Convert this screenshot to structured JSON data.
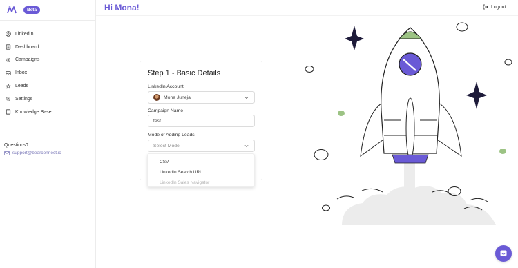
{
  "brand": {
    "badge": "Beta"
  },
  "header": {
    "greeting": "Hi Mona!",
    "logout_label": "Logout"
  },
  "sidebar": {
    "items": [
      {
        "label": "LinkedIn",
        "icon": "user-circle-icon"
      },
      {
        "label": "Dashboard",
        "icon": "document-icon"
      },
      {
        "label": "Campaigns",
        "icon": "gear-icon"
      },
      {
        "label": "Inbox",
        "icon": "inbox-icon"
      },
      {
        "label": "Leads",
        "icon": "star-icon"
      },
      {
        "label": "Settings",
        "icon": "gear-icon"
      },
      {
        "label": "Knowledge Base",
        "icon": "book-icon"
      }
    ],
    "questions_label": "Questions?",
    "support_email": "support@bearconnect.io"
  },
  "form": {
    "title": "Step 1 - Basic Details",
    "linkedin_account_label": "LinkedIn Account",
    "linkedin_account_value": "Mona Juneja",
    "campaign_name_label": "Campaign Name",
    "campaign_name_value": "test",
    "mode_label": "Mode of Adding Leads",
    "mode_placeholder": "Select Mode",
    "mode_options": [
      {
        "label": "CSV",
        "disabled": false
      },
      {
        "label": "LinkedIn Search URL",
        "disabled": false
      },
      {
        "label": "LinkedIn Sales Navigator",
        "disabled": true
      }
    ]
  },
  "colors": {
    "accent": "#6a5ad6",
    "rocket_green": "#9cc384",
    "rocket_purple": "#6a5ad6"
  }
}
